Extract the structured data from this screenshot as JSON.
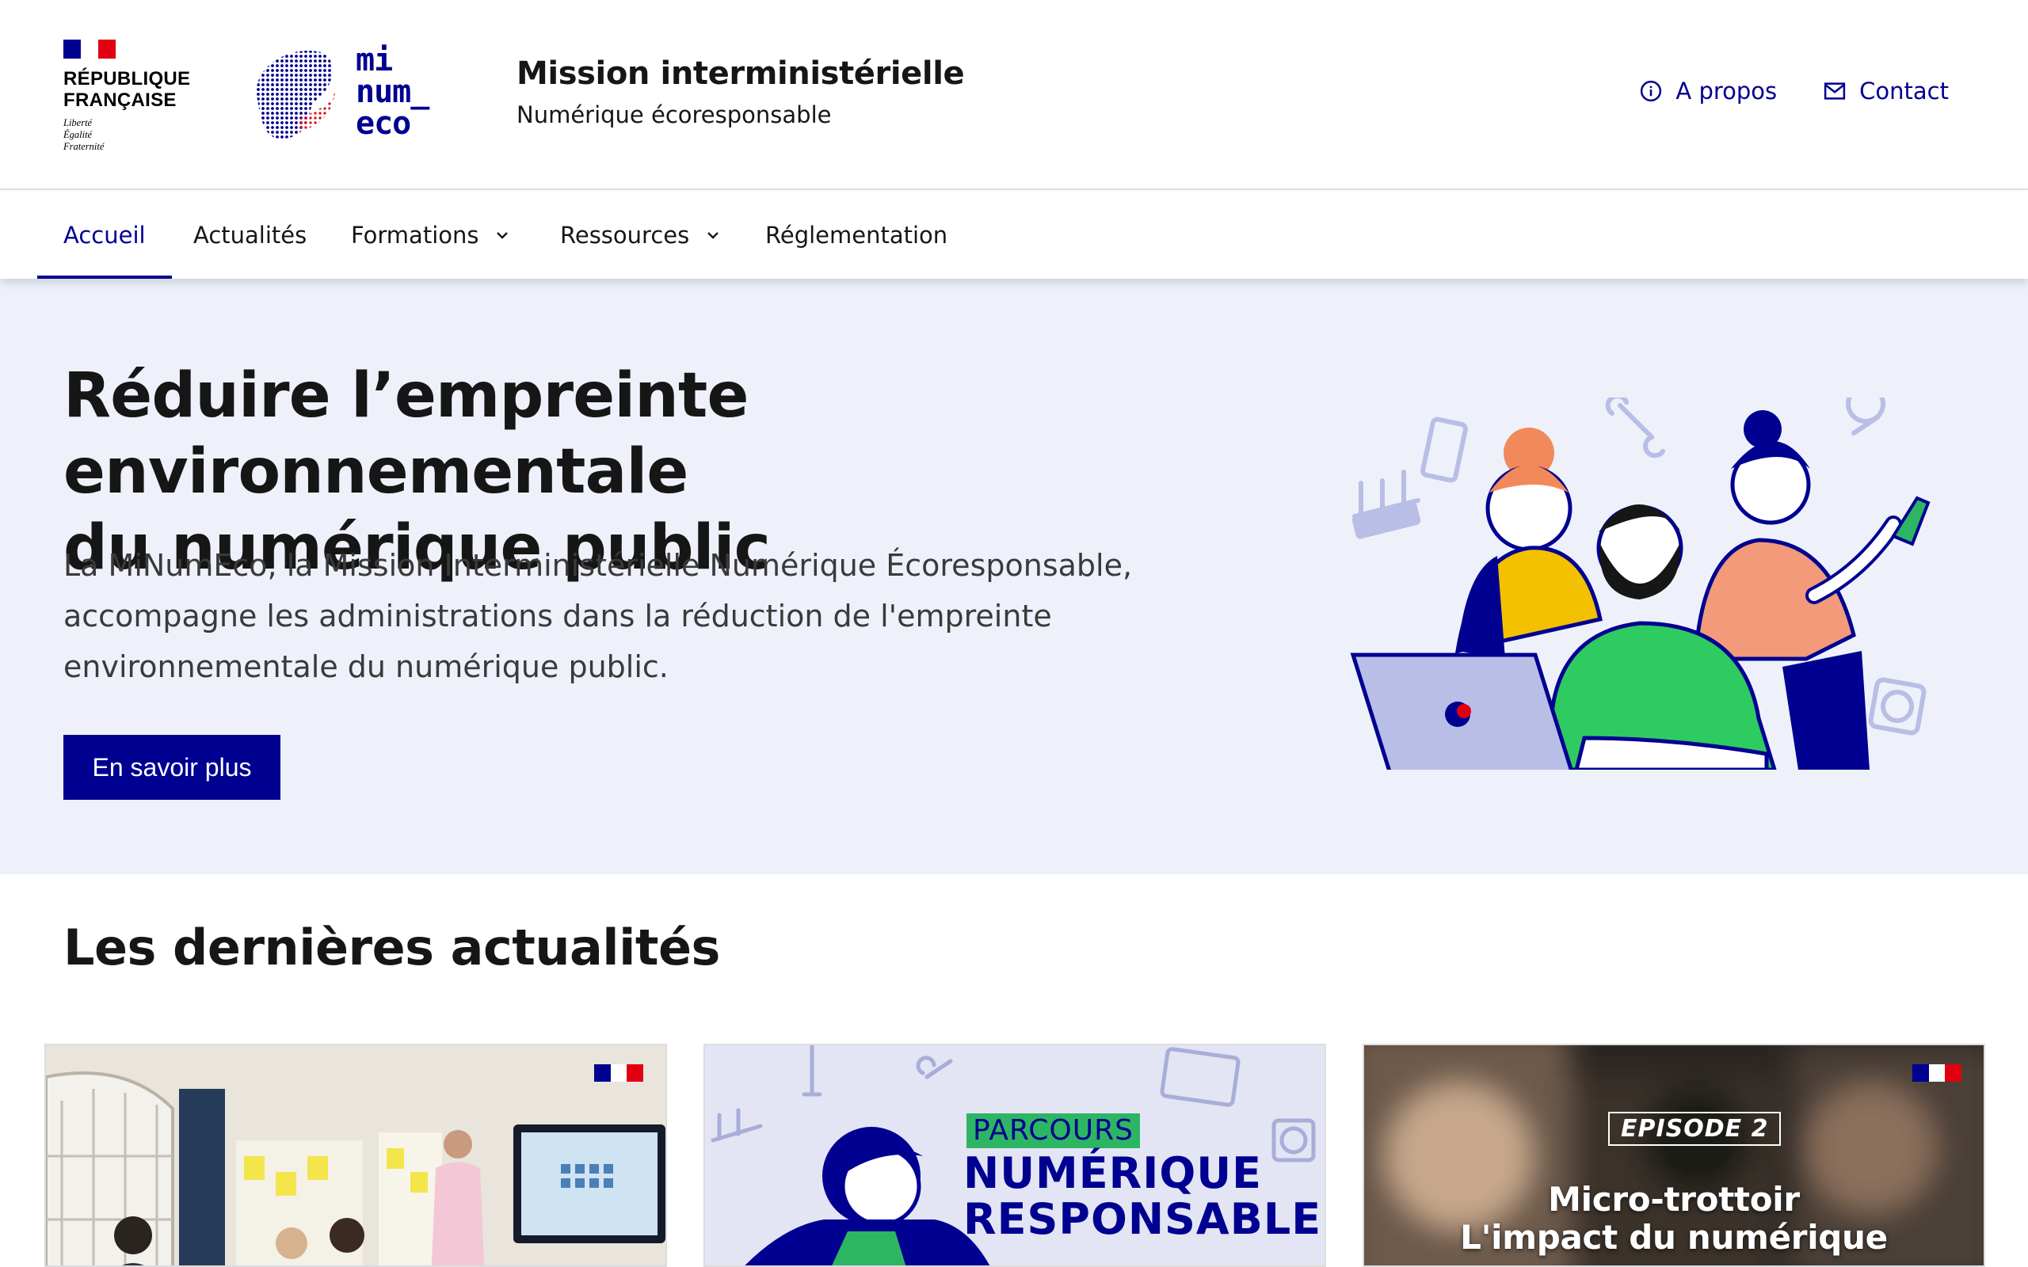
{
  "header": {
    "marianne": {
      "name_line1": "RÉPUBLIQUE",
      "name_line2": "FRANÇAISE",
      "motto_1": "Liberté",
      "motto_2": "Égalité",
      "motto_3": "Fraternité"
    },
    "operator_logo": {
      "line1": "mi",
      "line2": "num_",
      "line3": "eco"
    },
    "service_title": "Mission interministérielle",
    "service_tagline": "Numérique écoresponsable",
    "tools": [
      {
        "label": "A propos",
        "icon": "info-icon"
      },
      {
        "label": "Contact",
        "icon": "mail-icon"
      }
    ]
  },
  "nav": {
    "items": [
      {
        "label": "Accueil",
        "active": true
      },
      {
        "label": "Actualités"
      },
      {
        "label": "Formations",
        "dropdown": true
      },
      {
        "label": "Ressources",
        "dropdown": true
      },
      {
        "label": "Réglementation"
      }
    ]
  },
  "hero": {
    "title_line1": "Réduire l’empreinte environnementale",
    "title_line2": "du numérique public",
    "text": "La MiNumEco, la Mission Interministérielle Numérique Écoresponsable, accompagne les administrations dans la réduction de l'empreinte environnementale du numérique public.",
    "cta": "En savoir plus"
  },
  "news": {
    "title": "Les dernières actualités",
    "cards": [
      {
        "image": "photo of a presentation in a meeting room"
      },
      {
        "tag": "PARCOURS",
        "line1": "NUMÉRIQUE",
        "line2": "RESPONSABLE"
      },
      {
        "badge": "EPISODE 2",
        "line1": "Micro-trottoir",
        "line2": "L'impact du numérique"
      }
    ]
  },
  "colors": {
    "primary": "#000091",
    "accent_red": "#e1000f",
    "hero_bg": "#eef1fa",
    "green": "#2eb563"
  }
}
